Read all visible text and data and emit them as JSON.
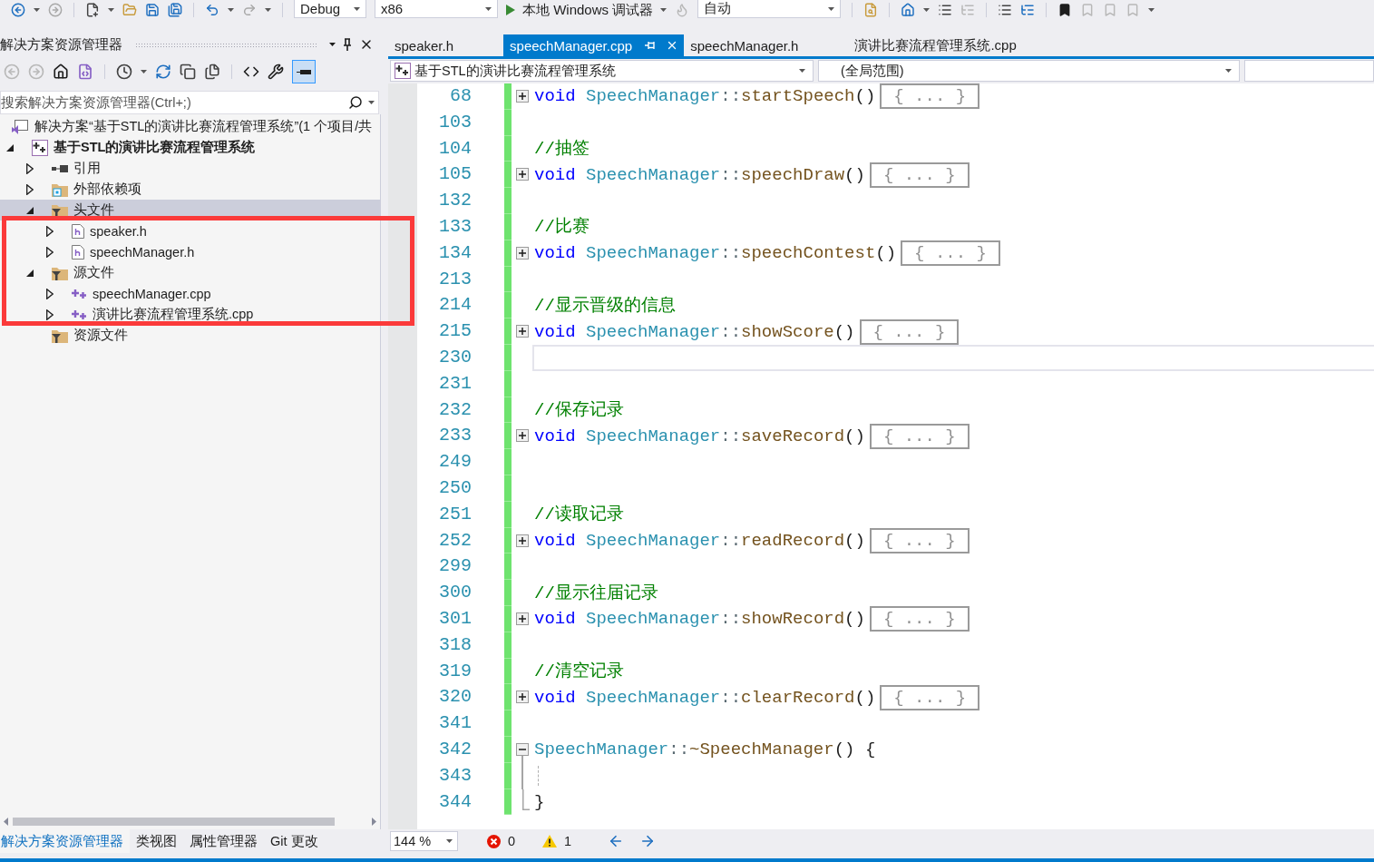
{
  "toolbar": {
    "configuration": "Debug",
    "platform": "x86",
    "run_button": "本地 Windows 调试器",
    "dropdown": "自动"
  },
  "solution_explorer": {
    "title": "解决方案资源管理器",
    "preview_button": {
      "pressed": true
    },
    "search": {
      "placeholder": "搜索解决方案资源管理器(Ctrl+;)"
    },
    "tree": [
      {
        "label": "解决方案“基于STL的演讲比赛流程管理系统”(1 个项目/共",
        "kind": "solution",
        "expander": false,
        "selected": false,
        "children": [
          {
            "label": "基于STL的演讲比赛流程管理系统",
            "kind": "project",
            "expander": true,
            "expanded": true,
            "selected": false,
            "children": [
              {
                "label": "引用",
                "kind": "references",
                "expander": true,
                "expanded": false,
                "selected": false
              },
              {
                "label": "外部依赖项",
                "kind": "dependencies",
                "expander": true,
                "expanded": false,
                "selected": false
              },
              {
                "label": "头文件",
                "kind": "filter",
                "expander": true,
                "expanded": true,
                "selected": true,
                "children": [
                  {
                    "label": "speaker.h",
                    "kind": "header",
                    "expander": true,
                    "expanded": false,
                    "selected": false
                  },
                  {
                    "label": "speechManager.h",
                    "kind": "header",
                    "expander": true,
                    "expanded": false,
                    "selected": false
                  }
                ]
              },
              {
                "label": "源文件",
                "kind": "filter",
                "expander": true,
                "expanded": true,
                "selected": false,
                "children": [
                  {
                    "label": "speechManager.cpp",
                    "kind": "source",
                    "expander": true,
                    "expanded": false,
                    "selected": false
                  },
                  {
                    "label": "演讲比赛流程管理系统.cpp",
                    "kind": "source",
                    "expander": true,
                    "expanded": false,
                    "selected": false
                  }
                ]
              },
              {
                "label": "资源文件",
                "kind": "filter",
                "expander": false,
                "selected": false
              }
            ]
          }
        ]
      }
    ],
    "bottom_tabs": [
      {
        "label": "解决方案资源管理器",
        "selected": true
      },
      {
        "label": "类视图",
        "selected": false
      },
      {
        "label": "属性管理器",
        "selected": false
      },
      {
        "label": "Git 更改",
        "selected": false
      }
    ]
  },
  "editor": {
    "tabs": [
      {
        "label": "speaker.h",
        "selected": false
      },
      {
        "label": "speechManager.cpp",
        "selected": true
      },
      {
        "label": "speechManager.h",
        "selected": false
      },
      {
        "label": "演讲比赛流程管理系统.cpp",
        "selected": false
      }
    ],
    "navigation": {
      "project": "基于STL的演讲比赛流程管理系统",
      "scope": "(全局范围)"
    },
    "lines": [
      {
        "number": "68",
        "kind": "folded",
        "changed": true,
        "current": false,
        "tokens": [
          {
            "kind": "keyword",
            "text": "void "
          },
          {
            "kind": "class",
            "text": "SpeechManager"
          },
          {
            "kind": "operator",
            "text": "::"
          },
          {
            "kind": "function",
            "text": "startSpeech"
          },
          {
            "kind": "plain",
            "text": "()"
          }
        ],
        "collapsed_text": "{ ... }"
      },
      {
        "number": "103",
        "kind": "blank",
        "changed": true,
        "current": false
      },
      {
        "number": "104",
        "kind": "comment",
        "changed": true,
        "current": false,
        "tokens": [
          {
            "kind": "comment",
            "text": "//抽签"
          }
        ]
      },
      {
        "number": "105",
        "kind": "folded",
        "changed": true,
        "current": false,
        "tokens": [
          {
            "kind": "keyword",
            "text": "void "
          },
          {
            "kind": "class",
            "text": "SpeechManager"
          },
          {
            "kind": "operator",
            "text": "::"
          },
          {
            "kind": "function",
            "text": "speechDraw"
          },
          {
            "kind": "plain",
            "text": "()"
          }
        ],
        "collapsed_text": "{ ... }"
      },
      {
        "number": "132",
        "kind": "blank",
        "changed": true,
        "current": false
      },
      {
        "number": "133",
        "kind": "comment",
        "changed": true,
        "current": false,
        "tokens": [
          {
            "kind": "comment",
            "text": "//比赛"
          }
        ]
      },
      {
        "number": "134",
        "kind": "folded",
        "changed": true,
        "current": false,
        "tokens": [
          {
            "kind": "keyword",
            "text": "void "
          },
          {
            "kind": "class",
            "text": "SpeechManager"
          },
          {
            "kind": "operator",
            "text": "::"
          },
          {
            "kind": "function",
            "text": "speechContest"
          },
          {
            "kind": "plain",
            "text": "()"
          }
        ],
        "collapsed_text": "{ ... }"
      },
      {
        "number": "213",
        "kind": "blank",
        "changed": true,
        "current": false
      },
      {
        "number": "214",
        "kind": "comment",
        "changed": true,
        "current": false,
        "tokens": [
          {
            "kind": "comment",
            "text": "//显示晋级的信息"
          }
        ]
      },
      {
        "number": "215",
        "kind": "folded",
        "changed": true,
        "current": false,
        "tokens": [
          {
            "kind": "keyword",
            "text": "void "
          },
          {
            "kind": "class",
            "text": "SpeechManager"
          },
          {
            "kind": "operator",
            "text": "::"
          },
          {
            "kind": "function",
            "text": "showScore"
          },
          {
            "kind": "plain",
            "text": "()"
          }
        ],
        "collapsed_text": "{ ... }"
      },
      {
        "number": "230",
        "kind": "blank",
        "changed": true,
        "current": true
      },
      {
        "number": "231",
        "kind": "blank",
        "changed": true,
        "current": false
      },
      {
        "number": "232",
        "kind": "comment",
        "changed": true,
        "current": false,
        "tokens": [
          {
            "kind": "comment",
            "text": "//保存记录"
          }
        ]
      },
      {
        "number": "233",
        "kind": "folded",
        "changed": true,
        "current": false,
        "tokens": [
          {
            "kind": "keyword",
            "text": "void "
          },
          {
            "kind": "class",
            "text": "SpeechManager"
          },
          {
            "kind": "operator",
            "text": "::"
          },
          {
            "kind": "function",
            "text": "saveRecord"
          },
          {
            "kind": "plain",
            "text": "()"
          }
        ],
        "collapsed_text": "{ ... }"
      },
      {
        "number": "249",
        "kind": "blank",
        "changed": true,
        "current": false
      },
      {
        "number": "250",
        "kind": "blank",
        "changed": true,
        "current": false
      },
      {
        "number": "251",
        "kind": "comment",
        "changed": true,
        "current": false,
        "tokens": [
          {
            "kind": "comment",
            "text": "//读取记录"
          }
        ]
      },
      {
        "number": "252",
        "kind": "folded",
        "changed": true,
        "current": false,
        "tokens": [
          {
            "kind": "keyword",
            "text": "void "
          },
          {
            "kind": "class",
            "text": "SpeechManager"
          },
          {
            "kind": "operator",
            "text": "::"
          },
          {
            "kind": "function",
            "text": "readRecord"
          },
          {
            "kind": "plain",
            "text": "()"
          }
        ],
        "collapsed_text": "{ ... }"
      },
      {
        "number": "299",
        "kind": "blank",
        "changed": true,
        "current": false
      },
      {
        "number": "300",
        "kind": "comment",
        "changed": true,
        "current": false,
        "tokens": [
          {
            "kind": "comment",
            "text": "//显示往届记录"
          }
        ]
      },
      {
        "number": "301",
        "kind": "folded",
        "changed": true,
        "current": false,
        "tokens": [
          {
            "kind": "keyword",
            "text": "void "
          },
          {
            "kind": "class",
            "text": "SpeechManager"
          },
          {
            "kind": "operator",
            "text": "::"
          },
          {
            "kind": "function",
            "text": "showRecord"
          },
          {
            "kind": "plain",
            "text": "()"
          }
        ],
        "collapsed_text": "{ ... }"
      },
      {
        "number": "318",
        "kind": "blank",
        "changed": true,
        "current": false
      },
      {
        "number": "319",
        "kind": "comment",
        "changed": true,
        "current": false,
        "tokens": [
          {
            "kind": "comment",
            "text": "//清空记录"
          }
        ]
      },
      {
        "number": "320",
        "kind": "folded",
        "changed": true,
        "current": false,
        "tokens": [
          {
            "kind": "keyword",
            "text": "void "
          },
          {
            "kind": "class",
            "text": "SpeechManager"
          },
          {
            "kind": "operator",
            "text": "::"
          },
          {
            "kind": "function",
            "text": "clearRecord"
          },
          {
            "kind": "plain",
            "text": "()"
          }
        ],
        "collapsed_text": "{ ... }"
      },
      {
        "number": "341",
        "kind": "blank",
        "changed": true,
        "current": false
      },
      {
        "number": "342",
        "kind": "block_start",
        "changed": true,
        "current": false,
        "tokens": [
          {
            "kind": "class",
            "text": "SpeechManager"
          },
          {
            "kind": "operator",
            "text": "::"
          },
          {
            "kind": "function",
            "text": "~SpeechManager"
          },
          {
            "kind": "plain",
            "text": "() {"
          }
        ]
      },
      {
        "number": "343",
        "kind": "block_body",
        "changed": true,
        "current": false
      },
      {
        "number": "344",
        "kind": "block_end",
        "changed": true,
        "current": false,
        "tokens": [
          {
            "kind": "plain",
            "text": "}"
          }
        ]
      }
    ],
    "status": {
      "zoom": "144 %",
      "errors": "0",
      "warnings": "1"
    }
  },
  "annotation": {
    "kind": "rectangle"
  }
}
